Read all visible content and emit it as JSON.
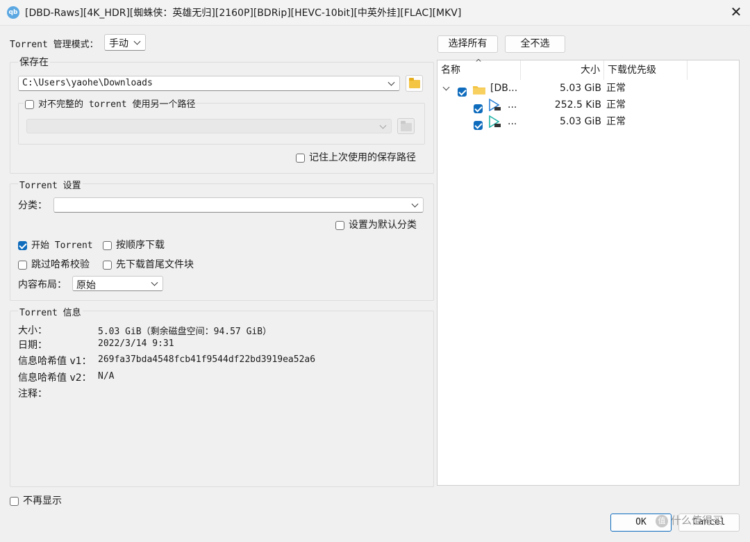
{
  "window": {
    "app_icon": "qb",
    "title": "[DBD-Raws][4K_HDR][蜘蛛侠：英雄无归][2160P][BDRip][HEVC-10bit][中英外挂][FLAC][MKV]",
    "close": "✕"
  },
  "management": {
    "label": "Torrent 管理模式：",
    "value": "手动"
  },
  "save_group": {
    "title": "保存在",
    "path": "C:\\Users\\yaohe\\Downloads",
    "incomplete_label": "对不完整的 torrent 使用另一个路径",
    "incomplete_checked": false,
    "incomplete_path": "",
    "remember_label": "记住上次使用的保存路径",
    "remember_checked": false
  },
  "settings_group": {
    "title": "Torrent 设置",
    "category_label": "分类：",
    "category_value": "",
    "default_category_label": "设置为默认分类",
    "default_category_checked": false,
    "start_label": "开始 Torrent",
    "start_checked": true,
    "sequential_label": "按顺序下载",
    "sequential_checked": false,
    "skip_hash_label": "跳过哈希校验",
    "skip_hash_checked": false,
    "first_last_label": "先下载首尾文件块",
    "first_last_checked": false,
    "layout_label": "内容布局：",
    "layout_value": "原始"
  },
  "info_group": {
    "title": "Torrent 信息",
    "size_label": "大小：",
    "size_value": "5.03 GiB（剩余磁盘空间：94.57 GiB）",
    "date_label": "日期：",
    "date_value": "2022/3/14 9:31",
    "hash_v1_label": "信息哈希值 v1：",
    "hash_v1_value": "269fa37bda4548fcb41f9544df22bd3919ea52a6",
    "hash_v2_label": "信息哈希值 v2：",
    "hash_v2_value": "N/A",
    "comment_label": "注释：",
    "comment_value": ""
  },
  "select_all": "选择所有",
  "select_none": "全不选",
  "tree": {
    "columns": [
      "名称",
      "大小",
      "下载优先级"
    ],
    "sort_indicator": "^",
    "rows": [
      {
        "name": "[DB...",
        "size": "5.03 GiB",
        "priority": "正常",
        "checked": true,
        "icon": "folder-icon"
      },
      {
        "name": "...",
        "size": "252.5 KiB",
        "priority": "正常",
        "checked": true,
        "icon": "video-file-icon"
      },
      {
        "name": "...",
        "size": "5.03 GiB",
        "priority": "正常",
        "checked": true,
        "icon": "video-file-icon"
      }
    ]
  },
  "dont_show_again": {
    "label": "不再显示",
    "checked": false
  },
  "buttons": {
    "ok": "OK",
    "cancel": "Cancel"
  },
  "watermark": {
    "icon_text": "值",
    "text": "什么值得买"
  },
  "colors": {
    "accent": "#0f6cbd",
    "folder": "#f4c443"
  }
}
